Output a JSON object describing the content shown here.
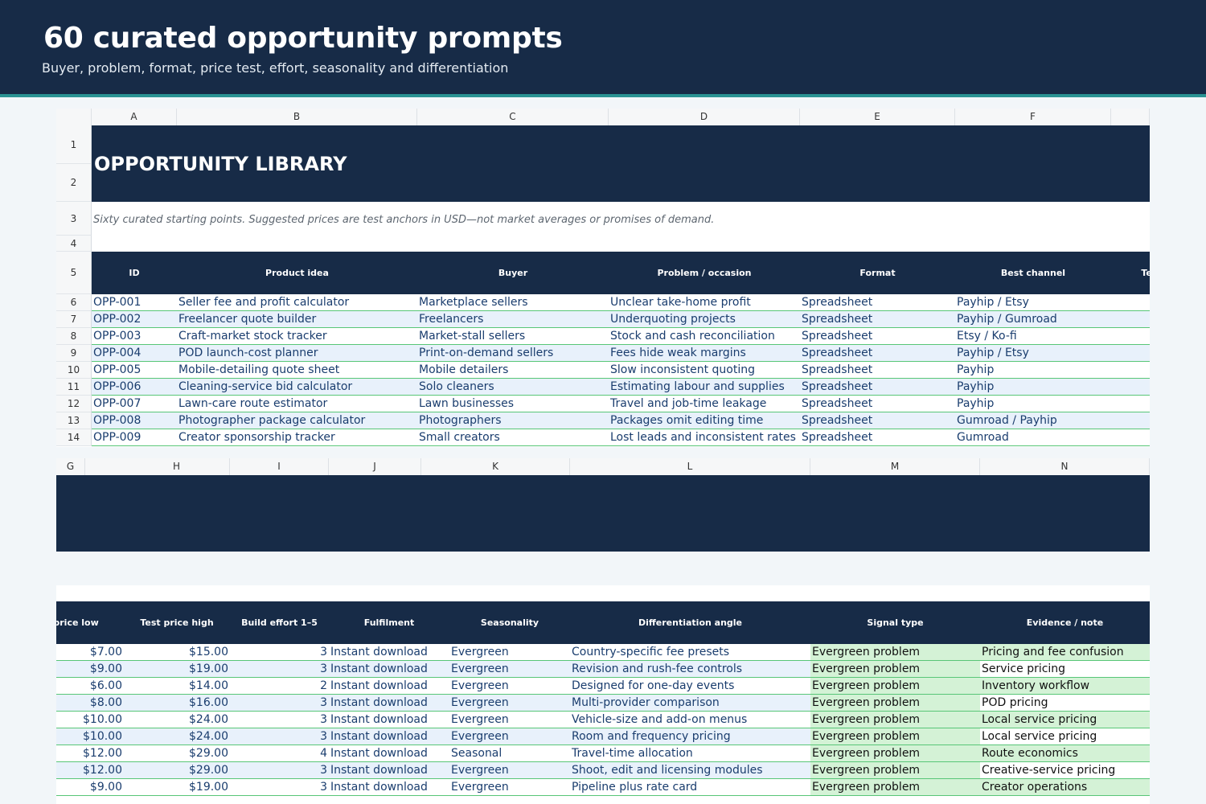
{
  "header": {
    "title": "60 curated opportunity prompts",
    "subtitle": "Buyer, problem, format, price test, effort, seasonality and differentiation"
  },
  "sheet_top": {
    "col_letters": [
      "A",
      "B",
      "C",
      "D",
      "E",
      "F"
    ],
    "row_numbers": [
      "1",
      "2",
      "3",
      "4",
      "5",
      "6",
      "7",
      "8",
      "9",
      "10",
      "11",
      "12",
      "13",
      "14"
    ],
    "title": "OPPORTUNITY LIBRARY",
    "note": "Sixty curated starting points. Suggested prices are test anchors in USD—not market averages or promises of demand.",
    "headers": [
      "ID",
      "Product idea",
      "Buyer",
      "Problem / occasion",
      "Format",
      "Best channel",
      "Test"
    ],
    "rows": [
      [
        "OPP-001",
        "Seller fee and profit calculator",
        "Marketplace sellers",
        "Unclear take-home profit",
        "Spreadsheet",
        "Payhip / Etsy"
      ],
      [
        "OPP-002",
        "Freelancer quote builder",
        "Freelancers",
        "Underquoting projects",
        "Spreadsheet",
        "Payhip / Gumroad"
      ],
      [
        "OPP-003",
        "Craft-market stock tracker",
        "Market-stall sellers",
        "Stock and cash reconciliation",
        "Spreadsheet",
        "Etsy / Ko-fi"
      ],
      [
        "OPP-004",
        "POD launch-cost planner",
        "Print-on-demand sellers",
        "Fees hide weak margins",
        "Spreadsheet",
        "Payhip / Etsy"
      ],
      [
        "OPP-005",
        "Mobile-detailing quote sheet",
        "Mobile detailers",
        "Slow inconsistent quoting",
        "Spreadsheet",
        "Payhip"
      ],
      [
        "OPP-006",
        "Cleaning-service bid calculator",
        "Solo cleaners",
        "Estimating labour and supplies",
        "Spreadsheet",
        "Payhip"
      ],
      [
        "OPP-007",
        "Lawn-care route estimator",
        "Lawn businesses",
        "Travel and job-time leakage",
        "Spreadsheet",
        "Payhip"
      ],
      [
        "OPP-008",
        "Photographer package calculator",
        "Photographers",
        "Packages omit editing time",
        "Spreadsheet",
        "Gumroad / Payhip"
      ],
      [
        "OPP-009",
        "Creator sponsorship tracker",
        "Small creators",
        "Lost leads and inconsistent rates",
        "Spreadsheet",
        "Gumroad"
      ]
    ]
  },
  "sheet_bottom": {
    "col_letters": [
      "G",
      "H",
      "I",
      "J",
      "K",
      "L",
      "M",
      "N"
    ],
    "headers": [
      "Test price low",
      "Test price high",
      "Build effort 1–5",
      "Fulfilment",
      "Seasonality",
      "Differentiation angle",
      "Signal type",
      "Evidence / note"
    ],
    "rows": [
      [
        "$7.00",
        "$15.00",
        "3",
        "Instant download",
        "Evergreen",
        "Country-specific fee presets",
        "Evergreen problem",
        "Pricing and fee confusion"
      ],
      [
        "$9.00",
        "$19.00",
        "3",
        "Instant download",
        "Evergreen",
        "Revision and rush-fee controls",
        "Evergreen problem",
        "Service pricing"
      ],
      [
        "$6.00",
        "$14.00",
        "2",
        "Instant download",
        "Evergreen",
        "Designed for one-day events",
        "Evergreen problem",
        "Inventory workflow"
      ],
      [
        "$8.00",
        "$16.00",
        "3",
        "Instant download",
        "Evergreen",
        "Multi-provider comparison",
        "Evergreen problem",
        "POD pricing"
      ],
      [
        "$10.00",
        "$24.00",
        "3",
        "Instant download",
        "Evergreen",
        "Vehicle-size and add-on menus",
        "Evergreen problem",
        "Local service pricing"
      ],
      [
        "$10.00",
        "$24.00",
        "3",
        "Instant download",
        "Evergreen",
        "Room and frequency pricing",
        "Evergreen problem",
        "Local service pricing"
      ],
      [
        "$12.00",
        "$29.00",
        "4",
        "Instant download",
        "Seasonal",
        "Travel-time allocation",
        "Evergreen problem",
        "Route economics"
      ],
      [
        "$12.00",
        "$29.00",
        "3",
        "Instant download",
        "Evergreen",
        "Shoot, edit and licensing modules",
        "Evergreen problem",
        "Creative-service pricing"
      ],
      [
        "$9.00",
        "$19.00",
        "3",
        "Instant download",
        "Evergreen",
        "Pipeline plus rate card",
        "Evergreen problem",
        "Creator operations"
      ]
    ]
  },
  "colors": {
    "navy": "#172b47",
    "teal_rule": "#2a9393",
    "row_alt": "#e8f1fb",
    "row_green": "#d4f2d6",
    "row_border": "#58c677",
    "text_blue": "#1a3d6e"
  }
}
